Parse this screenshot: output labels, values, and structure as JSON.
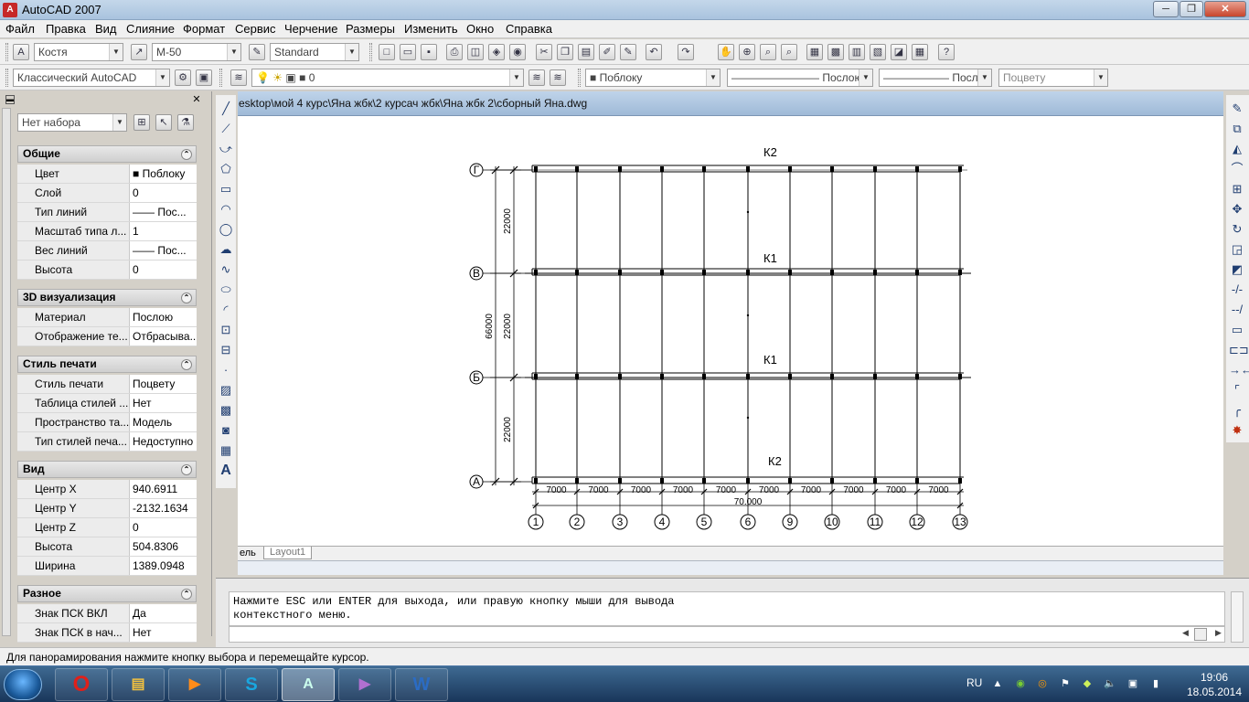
{
  "window": {
    "title": "AutoCAD 2007",
    "icon": "A"
  },
  "window_buttons": {
    "minimize": "─",
    "maximize": "❐",
    "close": "✕"
  },
  "menu": [
    "Файл",
    "Правка",
    "Вид",
    "Слияние",
    "Формат",
    "Сервис",
    "Черчение",
    "Размеры",
    "Изменить",
    "Окно",
    "Справка"
  ],
  "toolbar1": {
    "text_style": "Костя",
    "dim_style": "М-50",
    "table_style": "Standard"
  },
  "toolbar2": {
    "workspace": "Классический AutoCAD",
    "layer": "0",
    "color": "Поблоку",
    "linetype": "Послою",
    "lineweight": "Послою",
    "plotstyle": "Поцвету"
  },
  "properties": {
    "selection": "Нет набора",
    "categories": [
      {
        "title": "Общие",
        "rows": [
          {
            "label": "Цвет",
            "value": "Поблоку"
          },
          {
            "label": "Слой",
            "value": "0"
          },
          {
            "label": "Тип линий",
            "value": "—— Пос..."
          },
          {
            "label": "Масштаб типа л...",
            "value": "1"
          },
          {
            "label": "Вес линий",
            "value": "—— Пос..."
          },
          {
            "label": "Высота",
            "value": "0"
          }
        ]
      },
      {
        "title": "3D визуализация",
        "rows": [
          {
            "label": "Материал",
            "value": "Послою"
          },
          {
            "label": "Отображение те...",
            "value": "Отбрасыва..."
          }
        ]
      },
      {
        "title": "Стиль печати",
        "rows": [
          {
            "label": "Стиль печати",
            "value": "Поцвету"
          },
          {
            "label": "Таблица стилей ...",
            "value": "Нет"
          },
          {
            "label": "Пространство та...",
            "value": "Модель"
          },
          {
            "label": "Тип стилей печа...",
            "value": "Недоступно"
          }
        ]
      },
      {
        "title": "Вид",
        "rows": [
          {
            "label": "Центр X",
            "value": "940.6911"
          },
          {
            "label": "Центр Y",
            "value": "-2132.1634"
          },
          {
            "label": "Центр Z",
            "value": "0"
          },
          {
            "label": "Высота",
            "value": "504.8306"
          },
          {
            "label": "Ширина",
            "value": "1389.0948"
          }
        ]
      },
      {
        "title": "Разное",
        "rows": [
          {
            "label": "Знак ПСК ВКЛ",
            "value": "Да"
          },
          {
            "label": "Знак ПСК в нач...",
            "value": "Нет"
          }
        ]
      }
    ]
  },
  "document": {
    "path": "esktop\\мой 4 курс\\Яна жбк\\2 курсач жбк\\Яна жбк 2\\сборный Яна.dwg"
  },
  "drawing": {
    "row_axes": [
      "Г",
      "В",
      "Б",
      "А"
    ],
    "col_axes": [
      "1",
      "2",
      "3",
      "4",
      "5",
      "6",
      "9",
      "10",
      "11",
      "12",
      "13"
    ],
    "beam_labels": [
      "К2",
      "К1",
      "К1",
      "К2"
    ],
    "bay_dims": [
      "7000",
      "7000",
      "7000",
      "7000",
      "7000",
      "7000",
      "7000",
      "7000",
      "7000",
      "7000"
    ],
    "total_dim": "70.000",
    "span_dims": [
      "22000",
      "22000",
      "22000"
    ],
    "total_height_dim": "66000"
  },
  "layout_tabs": [
    "ель",
    "Layout1"
  ],
  "command_line": {
    "line1": "Нажмите ESC или ENTER для выхода, или правую кнопку мыши для вывода",
    "line2": "контекстного меню."
  },
  "status_text": "Для панорамирования нажмите кнопку выбора и перемещайте курсор.",
  "taskbar": {
    "lang": "RU",
    "time": "19:06",
    "date": "18.05.2014"
  }
}
